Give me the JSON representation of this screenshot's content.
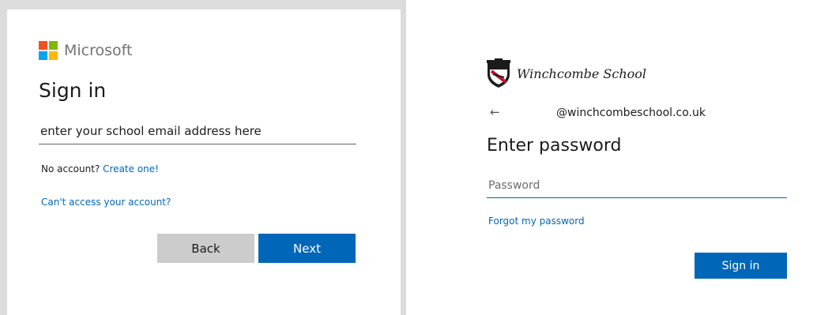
{
  "left_panel": {
    "brand": {
      "name": "Microsoft",
      "logo_colors": [
        "#f25022",
        "#7fba00",
        "#00a4ef",
        "#ffb900"
      ]
    },
    "title": "Sign in",
    "email_input": {
      "value": "enter your school email address here"
    },
    "no_account_text": "No account?",
    "create_link": "Create one!",
    "cant_access_link": "Can't access your account?",
    "back_button": "Back",
    "next_button": "Next"
  },
  "right_panel": {
    "school_name": "Winchcombe School",
    "crest_icon": "school-crest",
    "back_arrow": "←",
    "email_display": "@winchcombeschool.co.uk",
    "title": "Enter password",
    "password_input": {
      "placeholder": "Password",
      "value": ""
    },
    "forgot_link": "Forgot my password",
    "signin_button": "Sign in"
  },
  "colors": {
    "accent": "#0067b8",
    "back_button_bg": "#cccccc",
    "frame": "#dcdcdc"
  }
}
